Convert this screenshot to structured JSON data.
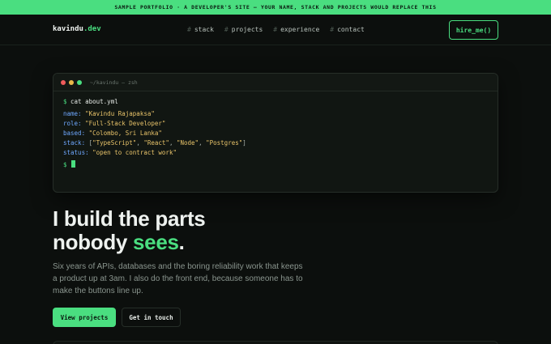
{
  "banner": {
    "text": "SAMPLE PORTFOLIO · A DEVELOPER'S SITE — YOUR NAME, STACK AND PROJECTS WOULD REPLACE THIS"
  },
  "nav": {
    "brand_name": "kavindu",
    "brand_tld": ".dev",
    "hash": "#",
    "links": [
      "stack",
      "projects",
      "experience",
      "contact"
    ],
    "cta": "hire_me()"
  },
  "terminal": {
    "title": "~/kavindu — zsh",
    "prompt": "$",
    "command": "cat about.yml",
    "fields": [
      {
        "key": "name:",
        "value": "\"Kavindu Rajapaksa\""
      },
      {
        "key": "role:",
        "value": "\"Full-Stack Developer\""
      },
      {
        "key": "based:",
        "value": "\"Colombo, Sri Lanka\""
      },
      {
        "key": "stack:",
        "list": [
          "\"TypeScript\"",
          "\"React\"",
          "\"Node\"",
          "\"Postgres\""
        ]
      },
      {
        "key": "status:",
        "value": "\"open to contract work\""
      }
    ]
  },
  "hero": {
    "line1": "I build the parts",
    "line2_start": "nobody ",
    "line2_accent": "sees",
    "line2_end": ".",
    "description": "Six years of APIs, databases and the boring reliability work that keeps a product up at 3am. I also do the front end, because someone has to make the buttons line up.",
    "primary_cta": "View projects",
    "secondary_cta": "Get in touch"
  },
  "colors": {
    "accent": "#4ade80",
    "background": "#0c0f0d",
    "key": "#6fa8ff",
    "string": "#e9c46a"
  }
}
